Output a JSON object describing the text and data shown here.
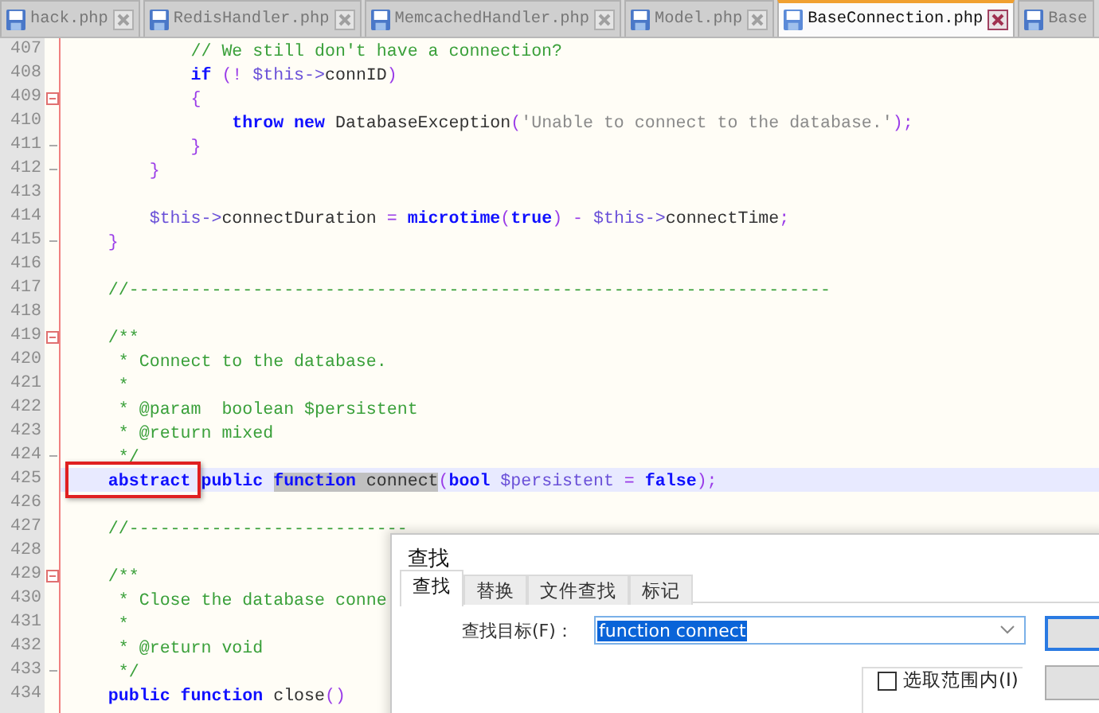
{
  "file_tabs": [
    {
      "name": "hack.php",
      "selected": false
    },
    {
      "name": "RedisHandler.php",
      "selected": false
    },
    {
      "name": "MemcachedHandler.php",
      "selected": false
    },
    {
      "name": "Model.php",
      "selected": false
    },
    {
      "name": "BaseConnection.php",
      "selected": true
    },
    {
      "name": "Base",
      "selected": false
    }
  ],
  "editor": {
    "lines": [
      {
        "number": "407",
        "tokens": [
          {
            "kind": "comment",
            "text": "            // We still don't have a connection?"
          }
        ]
      },
      {
        "number": "408",
        "tokens": [
          {
            "kind": "keyword",
            "text": "            if"
          },
          {
            "kind": "op",
            "text": " (! "
          },
          {
            "kind": "var",
            "text": "$this->"
          },
          {
            "kind": "plain",
            "text": "connID"
          },
          {
            "kind": "op",
            "text": ")"
          }
        ]
      },
      {
        "number": "409",
        "fold_start": true,
        "tokens": [
          {
            "kind": "op",
            "text": "            {"
          }
        ]
      },
      {
        "number": "410",
        "tokens": [
          {
            "kind": "keyword",
            "text": "                throw new"
          },
          {
            "kind": "plain",
            "text": " DatabaseException"
          },
          {
            "kind": "op",
            "text": "("
          },
          {
            "kind": "str",
            "text": "'Unable to connect to the database.'"
          },
          {
            "kind": "op",
            "text": ");"
          }
        ]
      },
      {
        "number": "411",
        "fold_end": true,
        "tokens": [
          {
            "kind": "op",
            "text": "            }"
          }
        ]
      },
      {
        "number": "412",
        "fold_end": true,
        "tokens": [
          {
            "kind": "op",
            "text": "        }"
          }
        ]
      },
      {
        "number": "413"
      },
      {
        "number": "414",
        "tokens": [
          {
            "kind": "var",
            "text": "        $this->"
          },
          {
            "kind": "plain",
            "text": "connectDuration "
          },
          {
            "kind": "op",
            "text": "= "
          },
          {
            "kind": "keyword",
            "text": "microtime"
          },
          {
            "kind": "op",
            "text": "("
          },
          {
            "kind": "keyword",
            "text": "true"
          },
          {
            "kind": "op",
            "text": ") - "
          },
          {
            "kind": "var",
            "text": "$this->"
          },
          {
            "kind": "plain",
            "text": "connectTime"
          },
          {
            "kind": "op",
            "text": ";"
          }
        ]
      },
      {
        "number": "415",
        "fold_end": true,
        "tokens": [
          {
            "kind": "op",
            "text": "    }"
          }
        ]
      },
      {
        "number": "416"
      },
      {
        "number": "417",
        "tokens": [
          {
            "kind": "comment",
            "text": "    //--------------------------------------------------------------------"
          }
        ]
      },
      {
        "number": "418"
      },
      {
        "number": "419",
        "fold_start": true,
        "tokens": [
          {
            "kind": "comment",
            "text": "    /**"
          }
        ]
      },
      {
        "number": "420",
        "tokens": [
          {
            "kind": "comment",
            "text": "     * Connect to the database."
          }
        ]
      },
      {
        "number": "421",
        "tokens": [
          {
            "kind": "comment",
            "text": "     *"
          }
        ]
      },
      {
        "number": "422",
        "tokens": [
          {
            "kind": "comment",
            "text": "     * @param  boolean $persistent"
          }
        ]
      },
      {
        "number": "423",
        "tokens": [
          {
            "kind": "comment",
            "text": "     * @return mixed"
          }
        ]
      },
      {
        "number": "424",
        "fold_end": true,
        "tokens": [
          {
            "kind": "comment",
            "text": "     */"
          }
        ]
      },
      {
        "number": "425",
        "current": true,
        "annotated": true,
        "tokens": [
          {
            "kind": "keyword",
            "text": "    abstract public "
          },
          {
            "kind": "keyword",
            "text": "function",
            "match": true
          },
          {
            "kind": "plain",
            "text": " connect",
            "match": true
          },
          {
            "kind": "op",
            "text": "("
          },
          {
            "kind": "keyword",
            "text": "bool "
          },
          {
            "kind": "var",
            "text": "$persistent"
          },
          {
            "kind": "op",
            "text": " = "
          },
          {
            "kind": "keyword",
            "text": "false"
          },
          {
            "kind": "op",
            "text": ");"
          }
        ]
      },
      {
        "number": "426"
      },
      {
        "number": "427",
        "tokens": [
          {
            "kind": "comment",
            "text": "    //---------------------------"
          }
        ]
      },
      {
        "number": "428"
      },
      {
        "number": "429",
        "fold_start": true,
        "tokens": [
          {
            "kind": "comment",
            "text": "    /**"
          }
        ]
      },
      {
        "number": "430",
        "tokens": [
          {
            "kind": "comment",
            "text": "     * Close the database conne"
          }
        ]
      },
      {
        "number": "431",
        "tokens": [
          {
            "kind": "comment",
            "text": "     *"
          }
        ]
      },
      {
        "number": "432",
        "tokens": [
          {
            "kind": "comment",
            "text": "     * @return void"
          }
        ]
      },
      {
        "number": "433",
        "fold_end": true,
        "tokens": [
          {
            "kind": "comment",
            "text": "     */"
          }
        ]
      },
      {
        "number": "434",
        "tokens": [
          {
            "kind": "keyword",
            "text": "    public function"
          },
          {
            "kind": "plain",
            "text": " close"
          },
          {
            "kind": "op",
            "text": "()"
          }
        ]
      }
    ]
  },
  "find_dialog": {
    "title": "查找",
    "tabs": [
      {
        "label": "查找",
        "selected": true
      },
      {
        "label": "替换",
        "selected": false
      },
      {
        "label": "文件查找",
        "selected": false
      },
      {
        "label": "标记",
        "selected": false
      }
    ],
    "find_label": "查找目标(F)：",
    "find_value": "function connect",
    "value_selected": true,
    "options": [
      {
        "label": "选取范围内(I)",
        "checked": false
      }
    ],
    "buttons": [
      {
        "default": true
      },
      {
        "default": false
      }
    ]
  }
}
